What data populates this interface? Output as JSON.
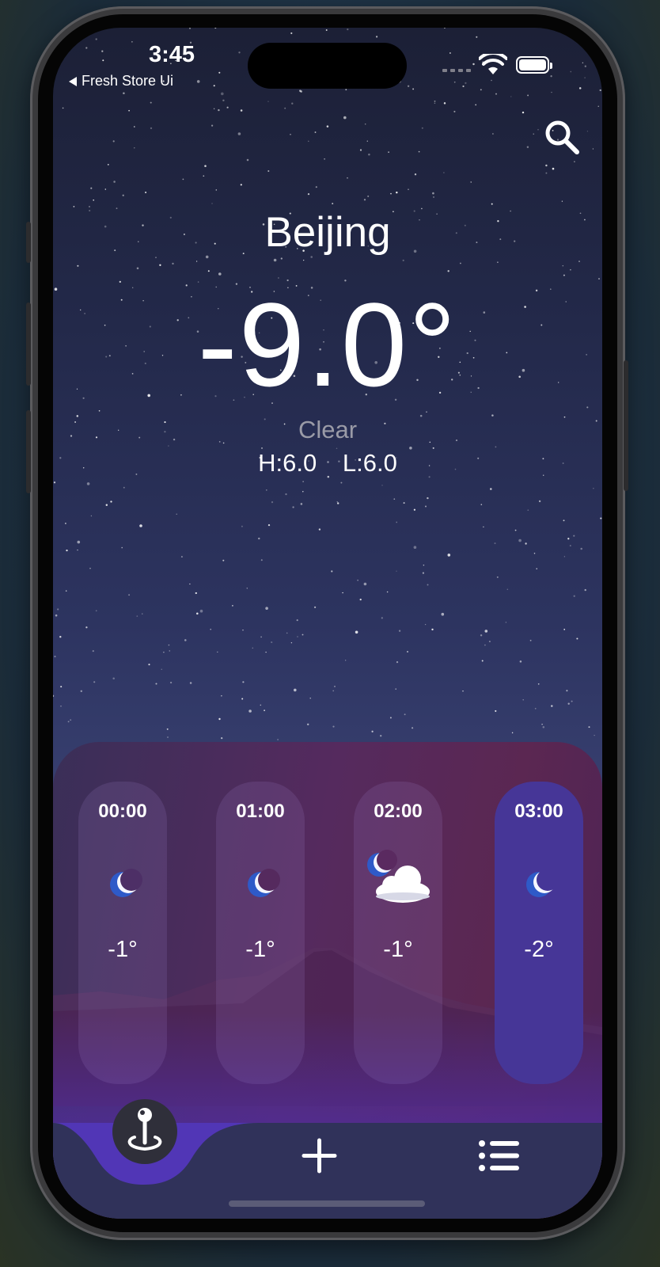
{
  "status_bar": {
    "time": "3:45",
    "back_app_label": "Fresh Store Ui",
    "icons": [
      "cellular-signal-icon",
      "wifi-icon",
      "battery-icon"
    ]
  },
  "header": {
    "search_icon": "search-icon"
  },
  "weather": {
    "city": "Beijing",
    "temperature": "-9.0°",
    "condition": "Clear",
    "high": "H:6.0",
    "low": "L:6.0"
  },
  "hourly": [
    {
      "time": "00:00",
      "icon": "crescent-moon-icon",
      "temp": "-1°",
      "selected": false
    },
    {
      "time": "01:00",
      "icon": "crescent-moon-icon",
      "temp": "-1°",
      "selected": false
    },
    {
      "time": "02:00",
      "icon": "moon-cloud-icon",
      "temp": "-1°",
      "selected": false
    },
    {
      "time": "03:00",
      "icon": "crescent-moon-icon",
      "temp": "-2°",
      "selected": true
    }
  ],
  "tab_bar": {
    "items": [
      {
        "name": "location",
        "icon": "map-pin-icon",
        "active": true
      },
      {
        "name": "add",
        "icon": "plus-icon",
        "active": false
      },
      {
        "name": "list",
        "icon": "list-icon",
        "active": false
      }
    ]
  },
  "colors": {
    "selected_card": "#463697",
    "tab_bar": "#30325a",
    "active_tab_wave": "#5136b6"
  }
}
